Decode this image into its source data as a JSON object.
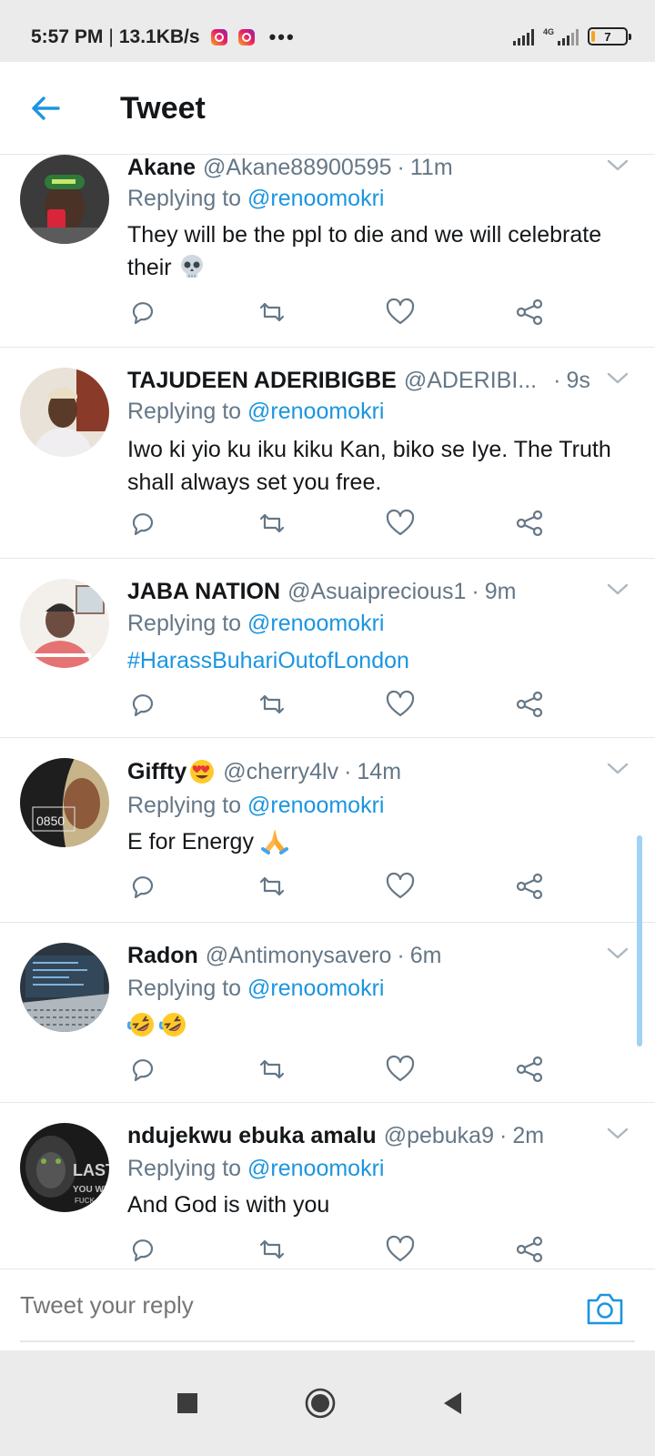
{
  "status_bar": {
    "time": "5:57 PM",
    "speed": "13.1KB/s",
    "more": "•••",
    "network": "4G",
    "battery": "7"
  },
  "header": {
    "title": "Tweet"
  },
  "colors": {
    "accent": "#1b95e0",
    "secondary_text": "#657786",
    "divider": "#e1e8ed",
    "system_bar": "#ebebeb"
  },
  "tweets": [
    {
      "name": "Akane",
      "handle": "@Akane88900595",
      "time": "11m",
      "replying_to": "Replying to",
      "mention": "@renoomokri",
      "text": "They will be the ppl to die and we will celebrate their",
      "emoji": "skull"
    },
    {
      "name": "TAJUDEEN ADERIBIGBE",
      "handle": "@ADERIBI...",
      "time": "9s",
      "replying_to": "Replying to",
      "mention": "@renoomokri",
      "text": "Iwo ki yio ku iku kiku Kan, biko se Iye. The Truth shall always set you free."
    },
    {
      "name": "JABA NATION",
      "handle": "@Asuaiprecious1",
      "time": "9m",
      "replying_to": "Replying to",
      "mention": "@renoomokri",
      "text": "#HarassBuhariOutofLondon"
    },
    {
      "name": "Giffty",
      "name_emoji": "heart-eyes",
      "handle": "@cherry4lv",
      "time": "14m",
      "replying_to": "Replying to",
      "mention": "@renoomokri",
      "text": "E for Energy",
      "emoji": "folded-hands"
    },
    {
      "name": "Radon",
      "handle": "@Antimonysavero",
      "time": "6m",
      "replying_to": "Replying to",
      "mention": "@renoomokri",
      "text": "",
      "emoji": "rolling-laughing x2"
    },
    {
      "name": "ndujekwu ebuka amalu",
      "handle": "@pebuka9",
      "time": "2m",
      "replying_to": "Replying to",
      "mention": "@renoomokri",
      "text": "And God is with you"
    }
  ],
  "avatar_text": {
    "giffty": "0850",
    "ndujekwu_line1": "LAST",
    "ndujekwu_line2": "YOU WI",
    "ndujekwu_line3": "FUCK"
  },
  "reply_bar": {
    "placeholder": "Tweet your reply"
  },
  "icons": {
    "back": "arrow-left-icon",
    "chevron": "chevron-down-icon",
    "reply": "comment-icon",
    "retweet": "retweet-icon",
    "like": "heart-icon",
    "share": "share-icon",
    "camera": "camera-icon",
    "nav_recents": "square-icon",
    "nav_home": "circle-icon",
    "nav_back": "triangle-back-icon"
  }
}
